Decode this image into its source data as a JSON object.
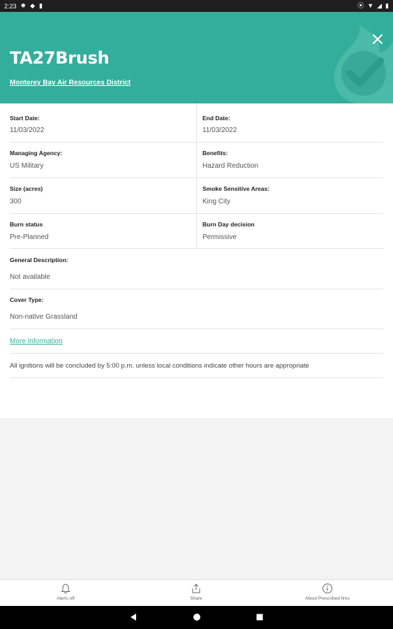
{
  "status_bar": {
    "time": "2:23"
  },
  "header": {
    "title": "TA27Brush",
    "district": "Monterey Bay Air Resources District",
    "close_icon": "close-icon",
    "accent_color": "#33ae9c"
  },
  "details": {
    "start_date": {
      "label": "Start Date:",
      "value": "11/03/2022"
    },
    "end_date": {
      "label": "End Date:",
      "value": "11/03/2022"
    },
    "managing_agency": {
      "label": "Managing Agency:",
      "value": "US Military"
    },
    "benefits": {
      "label": "Benefits:",
      "value": "Hazard Reduction"
    },
    "size": {
      "label": "Size (acres)",
      "value": "300"
    },
    "smoke_sensitive": {
      "label": "Smoke Sensitive Areas:",
      "value": "King City"
    },
    "burn_status": {
      "label": "Burn status",
      "value": "Pre-Planned"
    },
    "burn_day_decision": {
      "label": "Burn Day decision",
      "value": "Permissive"
    },
    "general_description": {
      "label": "General Description:",
      "value": "Not available"
    },
    "cover_type": {
      "label": "Cover Type:",
      "value": "Non-native Grassland"
    },
    "more_information": "More Information",
    "note": "All ignitions will be concluded by 5:00 p.m. unless local conditions indicate other hours are appropriate"
  },
  "bottom_nav": {
    "alerts": "Alerts off",
    "share": "Share",
    "about": "About Prescribed fires"
  }
}
